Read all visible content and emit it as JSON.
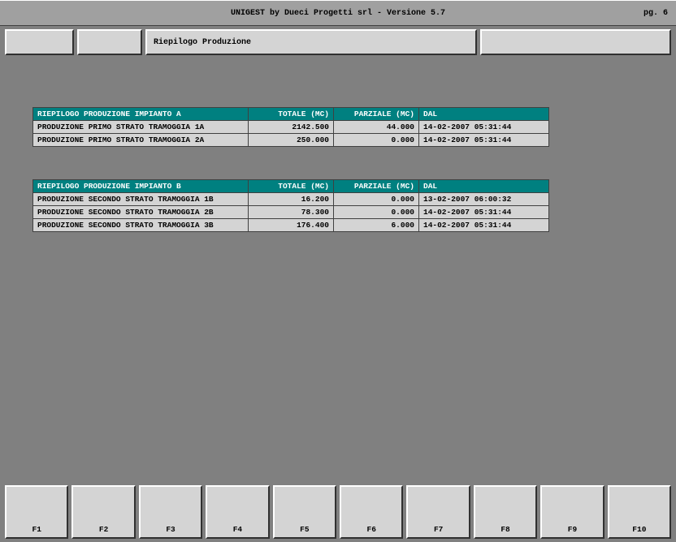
{
  "title": "UNIGEST  by Dueci Progetti srl - Versione 5.7",
  "page_label": "pg. 6",
  "header_caption": "Riepilogo Produzione",
  "tables": {
    "a": {
      "headers": {
        "desc": "RIEPILOGO PRODUZIONE IMPIANTO A",
        "tot": "TOTALE   (MC)",
        "par": "PARZIALE (MC)",
        "dal": "DAL"
      },
      "rows": [
        {
          "desc": "PRODUZIONE PRIMO STRATO TRAMOGGIA 1A",
          "tot": "2142.500",
          "par": "44.000",
          "dal": "14-02-2007  05:31:44"
        },
        {
          "desc": "PRODUZIONE PRIMO STRATO TRAMOGGIA 2A",
          "tot": "250.000",
          "par": "0.000",
          "dal": "14-02-2007  05:31:44"
        }
      ]
    },
    "b": {
      "headers": {
        "desc": "RIEPILOGO PRODUZIONE IMPIANTO B",
        "tot": "TOTALE   (MC)",
        "par": "PARZIALE (MC)",
        "dal": "DAL"
      },
      "rows": [
        {
          "desc": "PRODUZIONE SECONDO STRATO TRAMOGGIA 1B",
          "tot": "16.200",
          "par": "0.000",
          "dal": "13-02-2007  06:00:32"
        },
        {
          "desc": "PRODUZIONE SECONDO STRATO TRAMOGGIA 2B",
          "tot": "78.300",
          "par": "0.000",
          "dal": "14-02-2007  05:31:44"
        },
        {
          "desc": "PRODUZIONE SECONDO STRATO TRAMOGGIA 3B",
          "tot": "176.400",
          "par": "6.000",
          "dal": "14-02-2007  05:31:44"
        }
      ]
    }
  },
  "fkeys": [
    "F1",
    "F2",
    "F3",
    "F4",
    "F5",
    "F6",
    "F7",
    "F8",
    "F9",
    "F10"
  ]
}
